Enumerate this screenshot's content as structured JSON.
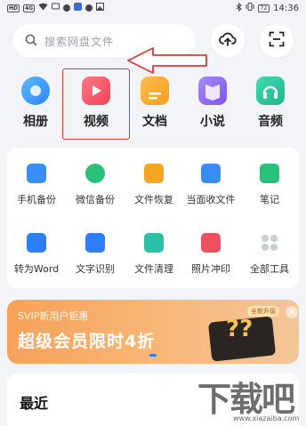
{
  "status_bar": {
    "left_chips": [
      "HD",
      "4G"
    ],
    "battery": "72",
    "time": "14:36"
  },
  "search": {
    "placeholder": "搜索网盘文件"
  },
  "header_buttons": {
    "upload_icon": "cloud-upload-icon",
    "scan_icon": "scan-icon"
  },
  "categories": [
    {
      "label": "相册",
      "icon": "album-icon",
      "color": "#3aa0ff"
    },
    {
      "label": "视频",
      "icon": "video-icon",
      "color": "#f2576a"
    },
    {
      "label": "文档",
      "icon": "document-icon",
      "color": "#f7a928"
    },
    {
      "label": "小说",
      "icon": "novel-icon",
      "color": "#8c63f0"
    },
    {
      "label": "音频",
      "icon": "audio-icon",
      "color": "#2cc9a0"
    }
  ],
  "annotation": {
    "highlight_color": "#d63a3a"
  },
  "tools": [
    {
      "label": "手机备份",
      "icon": "phone-backup-icon",
      "color": "#3a8cf5"
    },
    {
      "label": "微信备份",
      "icon": "wechat-backup-icon",
      "color": "#2bc07a"
    },
    {
      "label": "文件恢复",
      "icon": "file-restore-icon",
      "color": "#f5a623"
    },
    {
      "label": "当面收文件",
      "icon": "receive-file-icon",
      "color": "#3a8cf5"
    },
    {
      "label": "笔记",
      "icon": "note-icon",
      "color": "#2bc07a"
    },
    {
      "label": "转为Word",
      "icon": "word-convert-icon",
      "color": "#2d7ff9"
    },
    {
      "label": "文字识别",
      "icon": "ocr-icon",
      "color": "#2d7ff9"
    },
    {
      "label": "文件清理",
      "icon": "file-clean-icon",
      "color": "#2bc0a8"
    },
    {
      "label": "照片冲印",
      "icon": "photo-print-icon",
      "color": "#ef4f5e"
    },
    {
      "label": "全部工具",
      "icon": "all-tools-icon",
      "color": "#c9cdd4"
    }
  ],
  "banner": {
    "subtitle": "SVIP新用户钜惠",
    "title": "超级会员限时4折",
    "pill": "全新升级",
    "mark": "??",
    "close": "×"
  },
  "recent": {
    "title": "最近"
  },
  "watermark": {
    "text": "下载吧",
    "url": "www.xiazaiba.com"
  }
}
